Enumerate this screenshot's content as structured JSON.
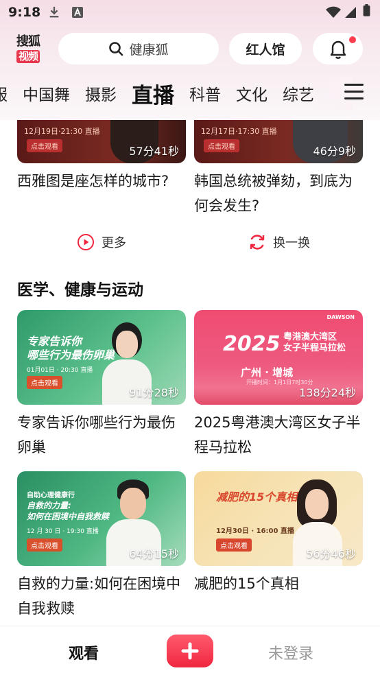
{
  "status": {
    "time": "9:18"
  },
  "header": {
    "brand_line1": "搜狐",
    "brand_line2": "视频",
    "search_placeholder": "健康狐",
    "pill_label": "红人馆"
  },
  "tabs": [
    "服",
    "中国舞",
    "摄影",
    "直播",
    "科普",
    "文化",
    "综艺"
  ],
  "active_tab": "直播",
  "top_cards": [
    {
      "title": "西雅图是座怎样的城市?",
      "duration": "57分41秒",
      "banner": "12月19日·21:30 直播",
      "btn": "点击观看"
    },
    {
      "title": "韩国总统被弹劾，到底为何会发生?",
      "duration": "46分9秒",
      "banner": "12月17日·17:30 直播",
      "btn": "点击观看"
    }
  ],
  "actions": {
    "more": "更多",
    "refresh": "换一换"
  },
  "section_title": "医学、健康与运动",
  "cards": [
    {
      "title": "专家告诉你哪些行为最伤卵巢",
      "duration": "91分28秒",
      "thumb_head": "专家告诉你\n哪些行为最伤卵巢",
      "thumb_date": "01月01日 · 20:30 直播",
      "thumb_btn": "点击观看"
    },
    {
      "title": "2025粤港澳大湾区女子半程马拉松",
      "duration": "138分24秒",
      "thumb_big": "2025",
      "thumb_head": "粤港澳大湾区\n女子半程马拉松",
      "thumb_city": "广州 · 增城",
      "thumb_date": "开播时间：1月1日7时30分",
      "thumb_logo": "DAWSON"
    },
    {
      "title": "自救的力量:如何在困境中自我救赎",
      "duration": "64分15秒",
      "thumb_head": "自救的力量:\n如何在困境中自我救赎",
      "thumb_small": "自助心理健康行",
      "thumb_date": "12 月 30 日 · 19:30 直播",
      "thumb_btn": "点击观看"
    },
    {
      "title": "减肥的15个真相",
      "duration": "56分46秒",
      "thumb_head": "减肥的15个真相",
      "thumb_date": "12月30日 · 16:00 直播",
      "thumb_btn": "点击观看"
    }
  ],
  "bottom_nav": {
    "watch": "观看",
    "login": "未登录"
  },
  "colors": {
    "accent": "#f0263f",
    "brand_red": "#e8374c"
  }
}
